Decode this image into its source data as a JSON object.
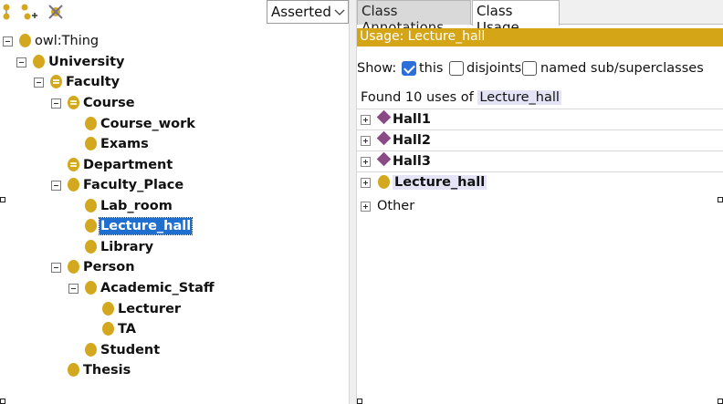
{
  "toolbar": {
    "icons": [
      "add-subclass-icon",
      "add-sibling-icon",
      "delete-class-icon"
    ],
    "view_select": "Asserted"
  },
  "tree": [
    {
      "label": "owl:Thing",
      "bold": false,
      "expanded": true,
      "icon": "class-dot"
    },
    {
      "label": "University",
      "bold": true,
      "expanded": true,
      "icon": "class-dot"
    },
    {
      "label": "Faculty",
      "bold": true,
      "expanded": true,
      "icon": "defined-class-dot"
    },
    {
      "label": "Course",
      "bold": true,
      "expanded": true,
      "icon": "defined-class-dot"
    },
    {
      "label": "Course_work",
      "bold": true,
      "expanded": null,
      "icon": "class-dot"
    },
    {
      "label": "Exams",
      "bold": true,
      "expanded": null,
      "icon": "class-dot"
    },
    {
      "label": "Department",
      "bold": true,
      "expanded": null,
      "icon": "defined-class-dot"
    },
    {
      "label": "Faculty_Place",
      "bold": true,
      "expanded": true,
      "icon": "class-dot"
    },
    {
      "label": "Lab_room",
      "bold": true,
      "expanded": null,
      "icon": "class-dot"
    },
    {
      "label": "Lecture_hall",
      "bold": true,
      "expanded": null,
      "icon": "class-dot",
      "selected": true
    },
    {
      "label": "Library",
      "bold": true,
      "expanded": null,
      "icon": "class-dot"
    },
    {
      "label": "Person",
      "bold": true,
      "expanded": true,
      "icon": "class-dot"
    },
    {
      "label": "Academic_Staff",
      "bold": true,
      "expanded": true,
      "icon": "class-dot"
    },
    {
      "label": "Lecturer",
      "bold": true,
      "expanded": null,
      "icon": "class-dot"
    },
    {
      "label": "TA",
      "bold": true,
      "expanded": null,
      "icon": "class-dot"
    },
    {
      "label": "Student",
      "bold": true,
      "expanded": null,
      "icon": "class-dot"
    },
    {
      "label": "Thesis",
      "bold": true,
      "expanded": null,
      "icon": "class-dot"
    }
  ],
  "tabs": [
    {
      "label": "Class Annotations",
      "active": false
    },
    {
      "label": "Class Usage",
      "active": true
    }
  ],
  "usage": {
    "header": "Usage: Lecture_hall",
    "show_label": "Show:",
    "options": [
      {
        "label": "this",
        "checked": true
      },
      {
        "label": "disjoints",
        "checked": false
      },
      {
        "label": "named sub/superclasses",
        "checked": false
      }
    ],
    "found_prefix": "Found 10 uses of",
    "found_class": "Lecture_hall",
    "results": [
      {
        "label": "Hall1",
        "icon": "individual-diamond-icon"
      },
      {
        "label": "Hall2",
        "icon": "individual-diamond-icon"
      },
      {
        "label": "Hall3",
        "icon": "individual-diamond-icon"
      },
      {
        "label": "Lecture_hall",
        "icon": "class-dot-icon",
        "highlight": true
      },
      {
        "label": "Other",
        "icon": null
      }
    ]
  },
  "colors": {
    "class_dot": "#d3a81e",
    "individual": "#8a4a86",
    "usage_bar": "#d4a517",
    "selection": "#1f6fd0",
    "checkbox_checked": "#2d6fd8"
  }
}
